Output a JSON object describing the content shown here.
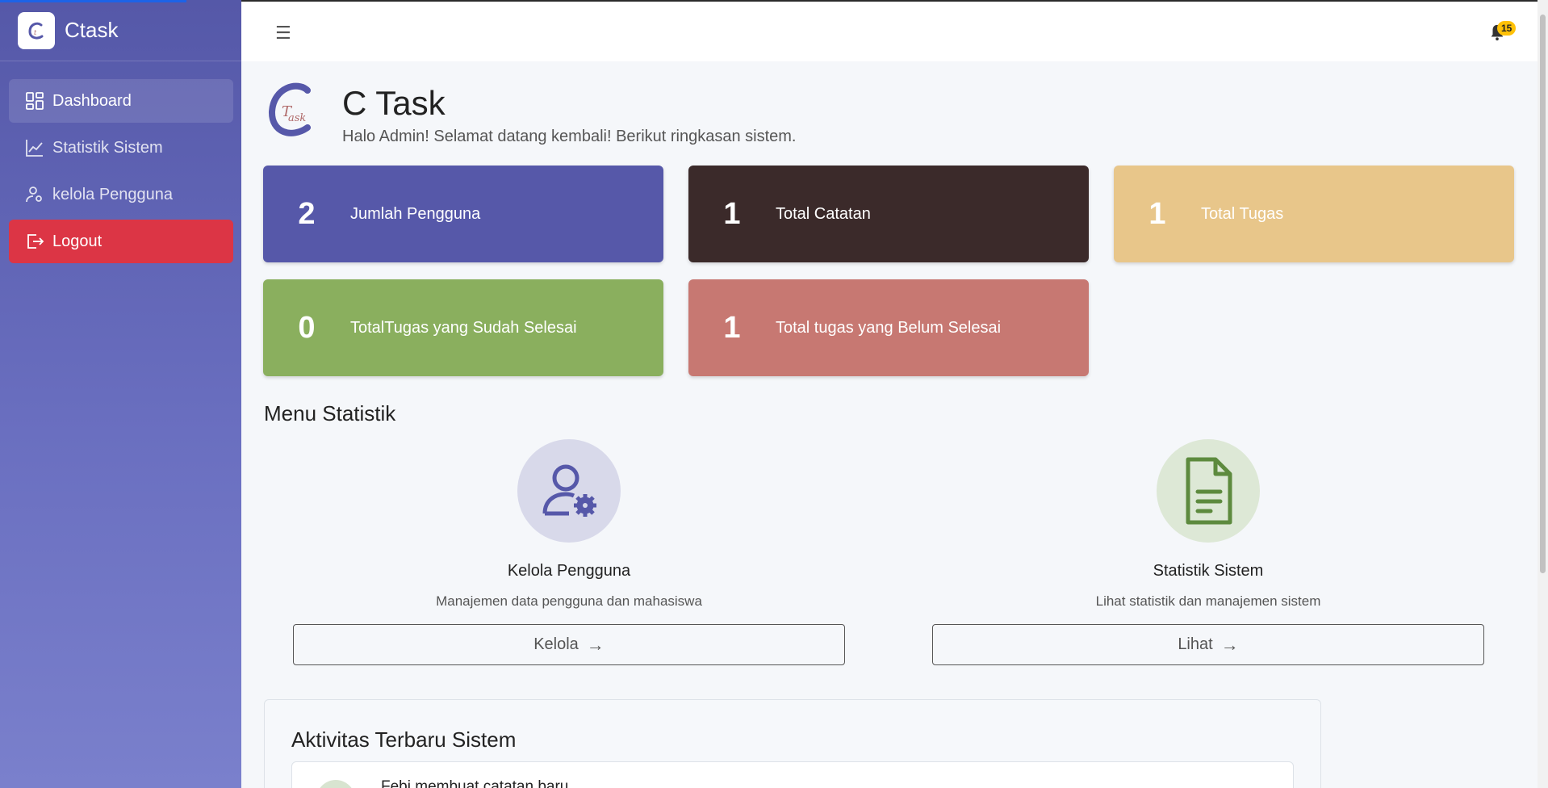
{
  "sidebar": {
    "brand": "Ctask",
    "items": [
      {
        "label": "Dashboard",
        "icon": "dashboard-icon"
      },
      {
        "label": "Statistik Sistem",
        "icon": "chart-line-icon"
      },
      {
        "label": "kelola Pengguna",
        "icon": "user-gear-icon"
      },
      {
        "label": "Logout",
        "icon": "logout-icon"
      }
    ]
  },
  "topbar": {
    "menu_icon": "hamburger-icon",
    "notification_icon": "bell-icon",
    "notification_count": "15"
  },
  "header": {
    "title": "C Task",
    "subtitle": "Halo Admin! Selamat datang kembali! Berikut ringkasan sistem."
  },
  "stats": [
    {
      "value": "2",
      "label": "Jumlah Pengguna",
      "color": "#5658a9"
    },
    {
      "value": "1",
      "label": "Total Catatan",
      "color": "#3b2a2a"
    },
    {
      "value": "1",
      "label": "Total Tugas",
      "color": "#e8c68a"
    },
    {
      "value": "0",
      "label": "TotalTugas yang Sudah Selesai",
      "color": "#8aaf5e"
    },
    {
      "value": "1",
      "label": "Total tugas yang Belum Selesai",
      "color": "#c77872"
    }
  ],
  "menu_statistik": {
    "title": "Menu Statistik",
    "items": [
      {
        "title": "Kelola Pengguna",
        "desc": "Manajemen data pengguna dan mahasiswa",
        "button": "Kelola",
        "icon": "user-gear-icon"
      },
      {
        "title": "Statistik Sistem",
        "desc": "Lihat statistik dan manajemen sistem",
        "button": "Lihat",
        "icon": "document-icon"
      }
    ]
  },
  "activity": {
    "title": "Aktivitas Terbaru Sistem",
    "items": [
      {
        "text": "Febi membuat catatan baru"
      }
    ]
  }
}
